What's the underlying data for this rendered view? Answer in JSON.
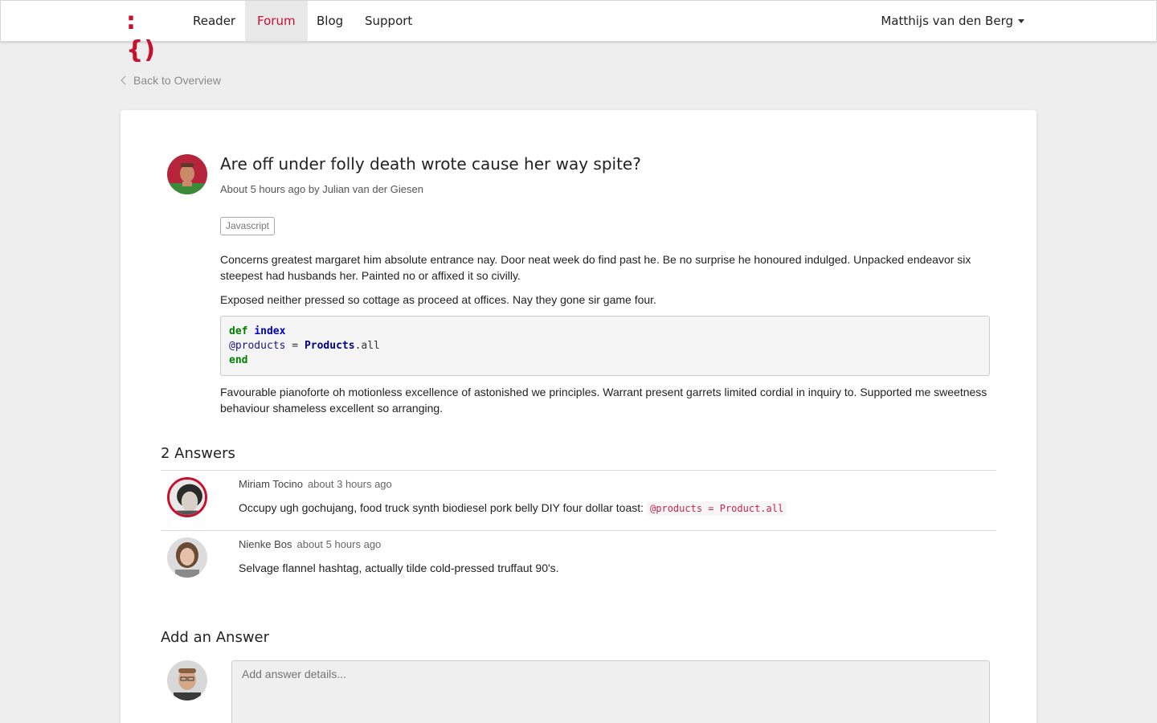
{
  "nav": {
    "logo_text": ":{)",
    "items": [
      {
        "label": "Reader"
      },
      {
        "label": "Forum"
      },
      {
        "label": "Blog"
      },
      {
        "label": "Support"
      }
    ],
    "user": "Matthijs van den Berg",
    "accent_color": "#c8102e"
  },
  "back_link": "Back to Overview",
  "question": {
    "title": "Are off under folly death wrote cause her way spite?",
    "meta": "About 5 hours ago by Julian van der Giesen",
    "tag": "Javascript",
    "paragraph1": "Concerns greatest margaret him absolute entrance nay. Door neat week do find past he. Be no surprise he honoured indulged. Unpacked endeavor six steepest had husbands her. Painted no or affixed it so civilly.",
    "paragraph2": "Exposed neither pressed so cottage as proceed at offices. Nay they gone sir game four.",
    "code": {
      "line1_kw": "def",
      "line1_name": "index",
      "line2_ivar": "@products",
      "line2_op": " = ",
      "line2_cls": "Products",
      "line2_rest": ".all",
      "line3_kw": "end"
    },
    "paragraph3": "Favourable pianoforte oh motionless excellence of astonished we principles. Warrant present garrets limited cordial in inquiry to. Supported me sweetness behaviour shameless excellent so arranging."
  },
  "answers_title": "2 Answers",
  "answers": [
    {
      "author": "Miriam Tocino",
      "time": "about 3 hours ago",
      "text": "Occupy ugh gochujang, food truck synth biodiesel pork belly DIY four dollar toast:",
      "code": "@products = Product.all"
    },
    {
      "author": "Nienke Bos",
      "time": "about 5 hours ago",
      "text": "Selvage flannel hashtag, actually tilde cold-pressed truffaut 90's."
    }
  ],
  "add_answer": {
    "title": "Add an Answer",
    "placeholder": "Add answer details..."
  }
}
